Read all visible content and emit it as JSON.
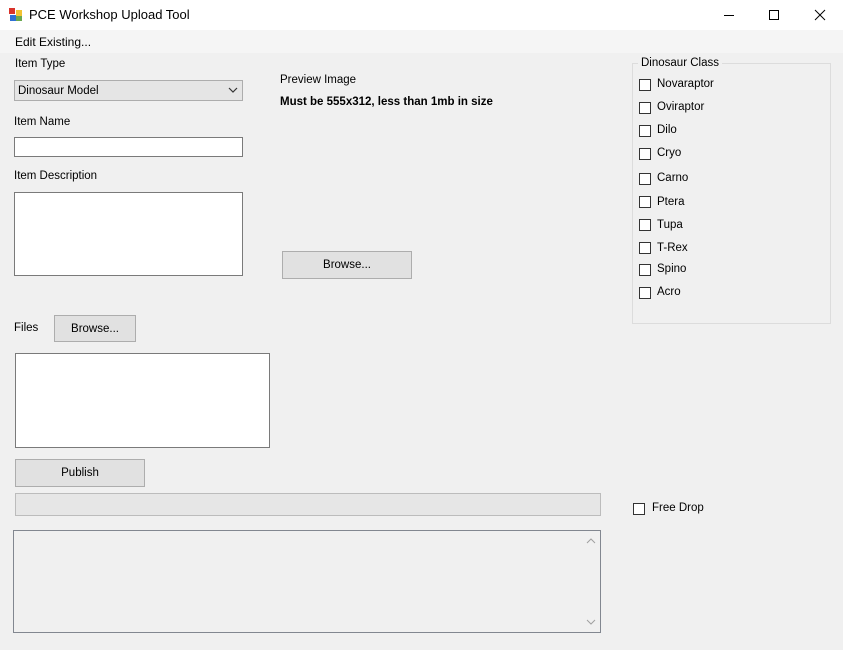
{
  "window": {
    "title": "PCE Workshop Upload Tool",
    "minimize_icon": "minimize-icon",
    "maximize_icon": "maximize-icon",
    "close_icon": "close-icon"
  },
  "menu": {
    "edit_existing": "Edit Existing..."
  },
  "item_type": {
    "label": "Item Type",
    "selected": "Dinosaur Model"
  },
  "item_name": {
    "label": "Item Name",
    "value": ""
  },
  "item_description": {
    "label": "Item Description",
    "value": ""
  },
  "preview": {
    "label": "Preview Image",
    "hint": "Must be 555x312, less than 1mb in size",
    "browse_label": "Browse..."
  },
  "files": {
    "label": "Files",
    "browse_label": "Browse..."
  },
  "publish": {
    "label": "Publish"
  },
  "progress": {
    "value": 0
  },
  "dinosaur_class": {
    "title": "Dinosaur Class",
    "options": [
      {
        "label": "Novaraptor",
        "checked": false
      },
      {
        "label": "Oviraptor",
        "checked": false
      },
      {
        "label": "Dilo",
        "checked": false
      },
      {
        "label": "Cryo",
        "checked": false
      },
      {
        "label": "Carno",
        "checked": false
      },
      {
        "label": "Ptera",
        "checked": false
      },
      {
        "label": "Tupa",
        "checked": false
      },
      {
        "label": "T-Rex",
        "checked": false
      },
      {
        "label": "Spino",
        "checked": false
      },
      {
        "label": "Acro",
        "checked": false
      }
    ]
  },
  "free_drop": {
    "label": "Free Drop",
    "checked": false
  },
  "log": {
    "value": ""
  }
}
